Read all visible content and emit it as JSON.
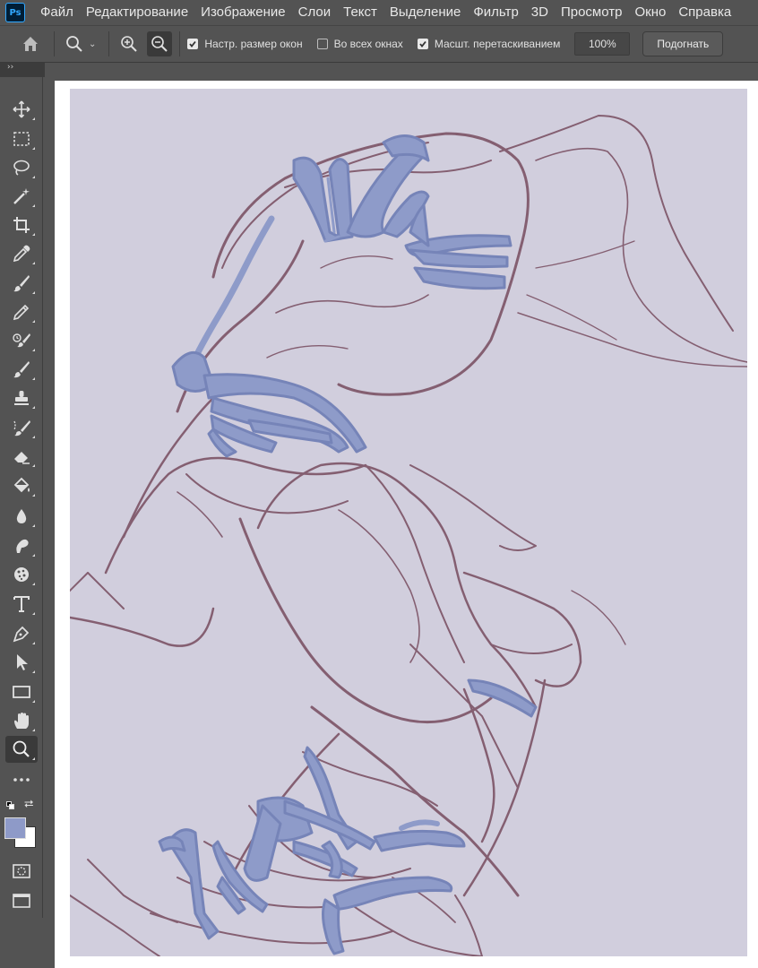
{
  "app": {
    "logo": "Ps"
  },
  "menu": [
    "Файл",
    "Редактирование",
    "Изображение",
    "Слои",
    "Текст",
    "Выделение",
    "Фильтр",
    "3D",
    "Просмотр",
    "Окно",
    "Справка"
  ],
  "options": {
    "resize_windows": {
      "label": "Настр. размер окон",
      "checked": true
    },
    "all_windows": {
      "label": "Во всех окнах",
      "checked": false
    },
    "scrubby_zoom": {
      "label": "Масшт. перетаскиванием",
      "checked": true
    },
    "zoom_value": "100%",
    "fit_label": "Подогнать"
  },
  "toolbar": {
    "collapse_glyph": "››",
    "tools": [
      "move-icon",
      "marquee-icon",
      "lasso-icon",
      "magic-wand-icon",
      "crop-icon",
      "eyedropper-icon",
      "brush-icon",
      "pencil-icon",
      "history-brush-icon",
      "mixer-brush-icon",
      "stamp-icon",
      "art-history-brush-icon",
      "eraser-icon",
      "paint-bucket-icon",
      "blur-drop-icon",
      "smudge-icon",
      "sponge-icon",
      "type-icon",
      "pen-icon",
      "path-selection-icon",
      "rectangle-icon",
      "hand-icon",
      "zoom-tool-icon",
      "more-tools-icon"
    ],
    "active_tool": "zoom-tool-icon"
  },
  "colors": {
    "foreground": "#8e9ac8",
    "background": "#ffffff",
    "canvas_bg": "#d1cedd",
    "sketch_line": "#6b3a4e",
    "overlay_fill": "#8e9bc9",
    "overlay_stroke": "#7684b8"
  }
}
